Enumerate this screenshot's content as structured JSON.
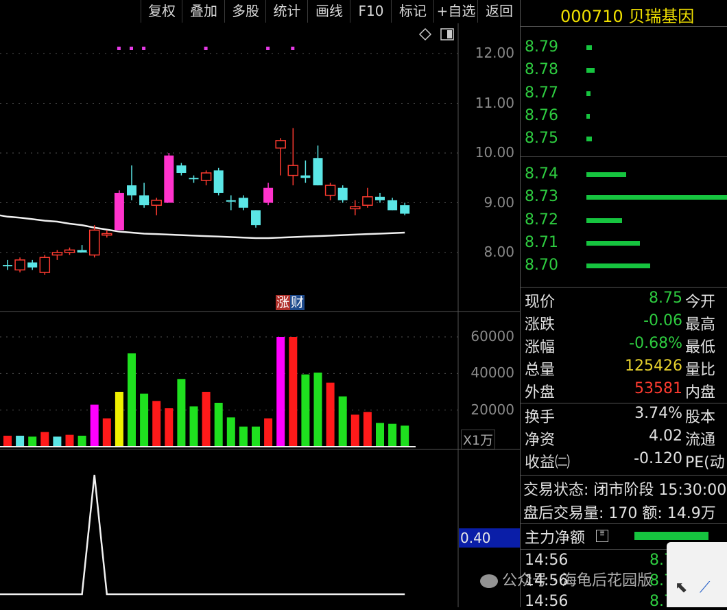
{
  "toolbar": {
    "buttons": [
      "复权",
      "叠加",
      "多股",
      "统计",
      "画线",
      "F10",
      "标记",
      "+自选",
      "返回"
    ]
  },
  "stock": {
    "code": "000710",
    "name": "贝瑞基因",
    "title": "000710 贝瑞基因"
  },
  "price_axis": {
    "labels": [
      "12.00",
      "11.00",
      "10.00",
      "9.00",
      "8.00"
    ]
  },
  "volume_axis": {
    "labels": [
      "60000",
      "40000",
      "20000"
    ],
    "unit": "X1万"
  },
  "indicator": {
    "value": "0.40"
  },
  "marker_badge": {
    "left": "涨",
    "right": "财"
  },
  "order_book": {
    "asks": [
      {
        "price": "8.79",
        "level": 0.04
      },
      {
        "price": "8.78",
        "level": 0.06
      },
      {
        "price": "8.77",
        "level": 0.03
      },
      {
        "price": "8.76",
        "level": 0.02
      },
      {
        "price": "8.75",
        "level": 0.04
      }
    ],
    "bids": [
      {
        "price": "8.74",
        "level": 0.28
      },
      {
        "price": "8.73",
        "level": 1.0
      },
      {
        "price": "8.72",
        "level": 0.25
      },
      {
        "price": "8.71",
        "level": 0.38
      },
      {
        "price": "8.70",
        "level": 0.45
      }
    ]
  },
  "quote_info": {
    "rows": [
      {
        "label": "现价",
        "value": "8.75",
        "color": "green",
        "label2": "今开"
      },
      {
        "label": "涨跌",
        "value": "-0.06",
        "color": "green",
        "label2": "最高"
      },
      {
        "label": "涨幅",
        "value": "-0.68%",
        "color": "green",
        "label2": "最低"
      },
      {
        "label": "总量",
        "value": "125426",
        "color": "yellow",
        "label2": "量比"
      },
      {
        "label": "外盘",
        "value": "53581",
        "color": "red",
        "label2": "内盘"
      }
    ],
    "rows2": [
      {
        "label": "换手",
        "value": "3.74%",
        "label2": "股本"
      },
      {
        "label": "净资",
        "value": "4.02",
        "label2": "流通"
      },
      {
        "label": "收益㈡",
        "value": "-0.120",
        "label2": "PE(动"
      }
    ]
  },
  "status": {
    "trade_state": "交易状态: 闭市阶段 15:30:00",
    "after_hours": "盘后交易量: 170  额: 14.9万"
  },
  "main_force": {
    "label": "主力净额",
    "icon": "list-icon",
    "level": 0.6
  },
  "ticks": [
    {
      "time": "14:56",
      "price": "8.7"
    },
    {
      "time": "14:56",
      "price": "8.7"
    },
    {
      "time": "14:56",
      "price": "8.7"
    }
  ],
  "watermark": {
    "text": "公众号 · 海龟后花园版"
  },
  "chart_data": [
    {
      "type": "candlestick",
      "ylim": [
        7.5,
        12.5
      ],
      "candles": [
        {
          "o": 7.75,
          "h": 7.85,
          "l": 7.65,
          "c": 7.75,
          "dir": "down"
        },
        {
          "o": 7.65,
          "h": 7.9,
          "l": 7.6,
          "c": 7.85,
          "dir": "up"
        },
        {
          "o": 7.8,
          "h": 7.85,
          "l": 7.65,
          "c": 7.7,
          "dir": "down"
        },
        {
          "o": 7.6,
          "h": 7.95,
          "l": 7.55,
          "c": 7.9,
          "dir": "up"
        },
        {
          "o": 7.95,
          "h": 8.05,
          "l": 7.85,
          "c": 8.0,
          "dir": "up"
        },
        {
          "o": 8.0,
          "h": 8.1,
          "l": 7.95,
          "c": 8.05,
          "dir": "up"
        },
        {
          "o": 8.05,
          "h": 8.15,
          "l": 8.0,
          "c": 8.0,
          "dir": "down"
        },
        {
          "o": 7.95,
          "h": 8.55,
          "l": 7.9,
          "c": 8.45,
          "dir": "up"
        },
        {
          "o": 8.35,
          "h": 8.45,
          "l": 8.3,
          "c": 8.38,
          "dir": "up"
        },
        {
          "o": 8.45,
          "h": 9.25,
          "l": 8.45,
          "c": 9.2,
          "dir": "up",
          "limit": true
        },
        {
          "o": 9.35,
          "h": 9.75,
          "l": 9.05,
          "c": 9.15,
          "dir": "down"
        },
        {
          "o": 9.15,
          "h": 9.4,
          "l": 8.9,
          "c": 8.95,
          "dir": "down"
        },
        {
          "o": 8.95,
          "h": 9.1,
          "l": 8.75,
          "c": 9.05,
          "dir": "up"
        },
        {
          "o": 9.0,
          "h": 10.0,
          "l": 9.0,
          "c": 9.95,
          "dir": "up",
          "limit": true
        },
        {
          "o": 9.75,
          "h": 9.8,
          "l": 9.55,
          "c": 9.6,
          "dir": "down"
        },
        {
          "o": 9.5,
          "h": 9.55,
          "l": 9.4,
          "c": 9.5,
          "dir": "down"
        },
        {
          "o": 9.45,
          "h": 9.65,
          "l": 9.35,
          "c": 9.6,
          "dir": "up"
        },
        {
          "o": 9.65,
          "h": 9.7,
          "l": 9.15,
          "c": 9.2,
          "dir": "down"
        },
        {
          "o": 9.05,
          "h": 9.15,
          "l": 8.85,
          "c": 9.05,
          "dir": "down"
        },
        {
          "o": 9.1,
          "h": 9.15,
          "l": 8.85,
          "c": 8.9,
          "dir": "down"
        },
        {
          "o": 8.85,
          "h": 8.85,
          "l": 8.5,
          "c": 8.55,
          "dir": "down"
        },
        {
          "o": 9.0,
          "h": 9.4,
          "l": 8.95,
          "c": 9.3,
          "dir": "up",
          "limit": true
        },
        {
          "o": 10.1,
          "h": 10.3,
          "l": 9.55,
          "c": 10.25,
          "dir": "up"
        },
        {
          "o": 9.55,
          "h": 10.5,
          "l": 9.35,
          "c": 9.75,
          "dir": "up"
        },
        {
          "o": 9.55,
          "h": 9.85,
          "l": 9.4,
          "c": 9.5,
          "dir": "down"
        },
        {
          "o": 9.9,
          "h": 10.15,
          "l": 9.35,
          "c": 9.35,
          "dir": "down"
        },
        {
          "o": 9.15,
          "h": 9.4,
          "l": 9.05,
          "c": 9.35,
          "dir": "up"
        },
        {
          "o": 9.3,
          "h": 9.35,
          "l": 9.0,
          "c": 9.05,
          "dir": "down"
        },
        {
          "o": 8.88,
          "h": 9.05,
          "l": 8.75,
          "c": 8.92,
          "dir": "up"
        },
        {
          "o": 8.95,
          "h": 9.3,
          "l": 8.9,
          "c": 9.12,
          "dir": "up"
        },
        {
          "o": 9.12,
          "h": 9.2,
          "l": 9.0,
          "c": 9.05,
          "dir": "down"
        },
        {
          "o": 9.05,
          "h": 9.1,
          "l": 8.85,
          "c": 8.85,
          "dir": "down"
        },
        {
          "o": 8.95,
          "h": 9.0,
          "l": 8.75,
          "c": 8.78,
          "dir": "down"
        }
      ],
      "ma": [
        8.72,
        8.7,
        8.67,
        8.64,
        8.62,
        8.58,
        8.55,
        8.5,
        8.46,
        8.42,
        8.4,
        8.38,
        8.37,
        8.36,
        8.35,
        8.34,
        8.33,
        8.32,
        8.31,
        8.3,
        8.29,
        8.29,
        8.3,
        8.31,
        8.32,
        8.33,
        8.34,
        8.35,
        8.36,
        8.37,
        8.38,
        8.39,
        8.4
      ],
      "signal_dots": [
        9,
        10,
        11,
        16,
        21,
        23
      ]
    },
    {
      "type": "bar",
      "series_name": "volume",
      "ylim": [
        0,
        70000
      ],
      "values": [
        6000,
        6000,
        5500,
        8000,
        5500,
        6500,
        6000,
        23000,
        15500,
        30000,
        51000,
        29000,
        25000,
        21000,
        37000,
        22000,
        30000,
        24000,
        16000,
        11000,
        11000,
        15500,
        60000,
        60000,
        39500,
        40500,
        35000,
        27500,
        17500,
        19000,
        13000,
        12500,
        11500
      ],
      "colors": [
        "red",
        "cyan",
        "green",
        "red",
        "cyan",
        "red",
        "green",
        "magenta",
        "red",
        "yellow",
        "green",
        "green",
        "red",
        "red",
        "green",
        "green",
        "red",
        "green",
        "green",
        "green",
        "green",
        "red",
        "magenta",
        "red",
        "green",
        "green",
        "red",
        "green",
        "red",
        "red",
        "green",
        "green",
        "green"
      ]
    },
    {
      "type": "line",
      "series_name": "indicator",
      "values": [
        0,
        0,
        0,
        0,
        0,
        0,
        0,
        1,
        0,
        0,
        0,
        0,
        0,
        0,
        0,
        0,
        0,
        0,
        0,
        0,
        0,
        0,
        0,
        0,
        0,
        0,
        0,
        0,
        0,
        0,
        0,
        0,
        0
      ]
    }
  ]
}
